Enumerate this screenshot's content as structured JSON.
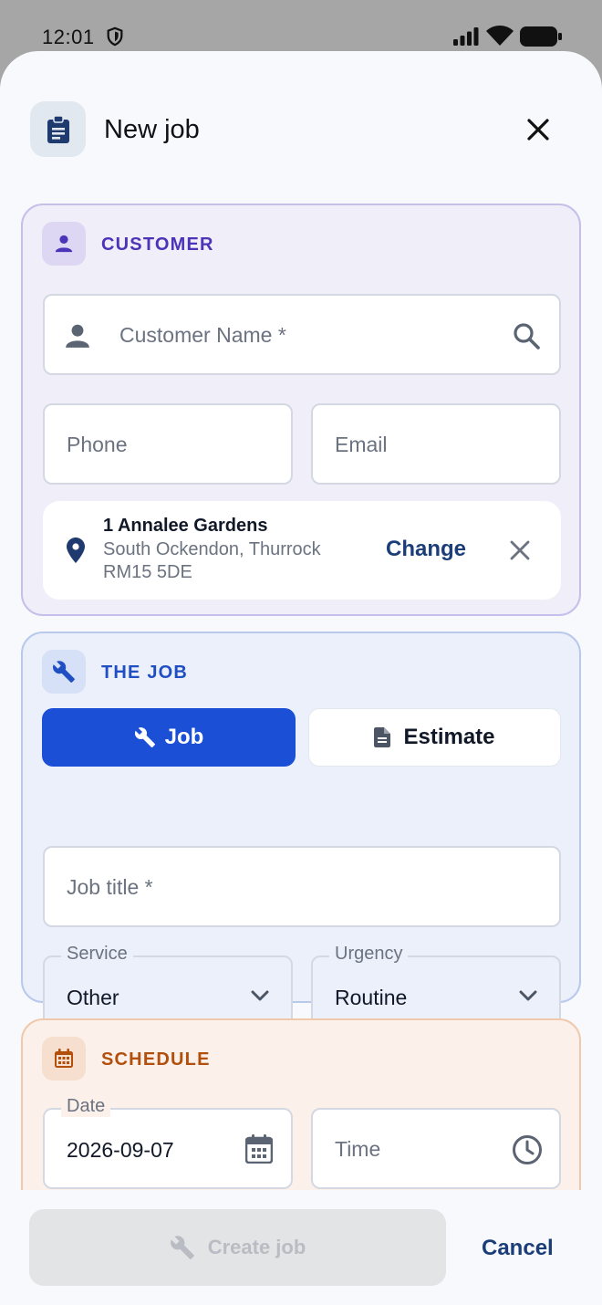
{
  "status_bar": {
    "time": "12:01"
  },
  "header": {
    "title": "New job",
    "icon": "clipboard-icon"
  },
  "customer": {
    "section_title": "CUSTOMER",
    "name_placeholder": "Customer Name *",
    "phone_placeholder": "Phone",
    "email_placeholder": "Email",
    "address": {
      "line1": "1 Annalee Gardens",
      "line2": "South Ockendon, Thurrock",
      "line3": "RM15 5DE",
      "change_label": "Change"
    }
  },
  "job": {
    "section_title": "THE JOB",
    "type_job_label": "Job",
    "type_estimate_label": "Estimate",
    "selected_type": "Job",
    "title_placeholder": "Job title *",
    "service_label": "Service",
    "service_value": "Other",
    "urgency_label": "Urgency",
    "urgency_value": "Routine"
  },
  "schedule": {
    "section_title": "SCHEDULE",
    "date_label": "Date",
    "date_value": "2026-09-07",
    "time_placeholder": "Time"
  },
  "actions": {
    "create_label": "Create job",
    "cancel_label": "Cancel"
  },
  "colors": {
    "customer_accent": "#4c33b8",
    "job_accent": "#1f4fc2",
    "schedule_accent": "#b34f0d",
    "primary": "#1a4fd6",
    "link": "#1c3e78"
  }
}
